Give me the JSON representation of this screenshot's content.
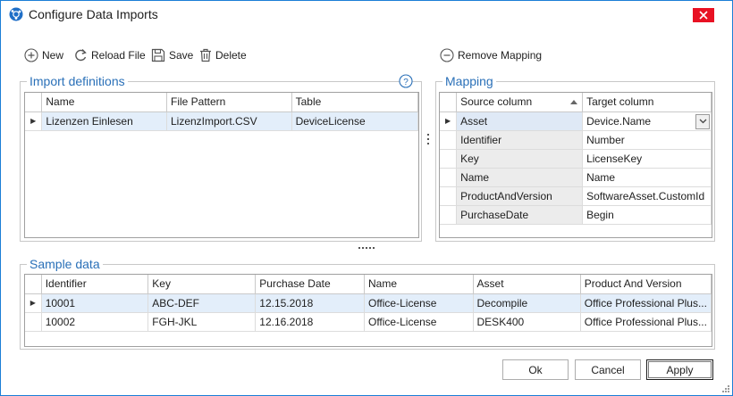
{
  "window": {
    "title": "Configure Data Imports"
  },
  "toolbar": {
    "new_label": "New",
    "reload_label": "Reload File",
    "save_label": "Save",
    "delete_label": "Delete",
    "remove_mapping_label": "Remove Mapping"
  },
  "import_definitions": {
    "title": "Import definitions",
    "columns": [
      "Name",
      "File Pattern",
      "Table"
    ],
    "rows": [
      [
        "Lizenzen Einlesen",
        "LizenzImport.CSV",
        "DeviceLicense"
      ]
    ]
  },
  "mapping": {
    "title": "Mapping",
    "columns": [
      "Source column",
      "Target column"
    ],
    "rows": [
      [
        "Asset",
        "Device.Name"
      ],
      [
        "Identifier",
        "Number"
      ],
      [
        "Key",
        "LicenseKey"
      ],
      [
        "Name",
        "Name"
      ],
      [
        "ProductAndVersion",
        "SoftwareAsset.CustomId"
      ],
      [
        "PurchaseDate",
        "Begin"
      ]
    ]
  },
  "sample_data": {
    "title": "Sample data",
    "columns": [
      "Identifier",
      "Key",
      "Purchase Date",
      "Name",
      "Asset",
      "Product And Version"
    ],
    "rows": [
      [
        "10001",
        "ABC-DEF",
        "12.15.2018",
        "Office-License",
        "Decompile",
        "Office Professional Plus..."
      ],
      [
        "10002",
        "FGH-JKL",
        "12.16.2018",
        "Office-License",
        "DESK400",
        "Office Professional Plus..."
      ]
    ]
  },
  "footer": {
    "ok_label": "Ok",
    "cancel_label": "Cancel",
    "apply_label": "Apply"
  },
  "colors": {
    "accent": "#2a70b8",
    "close": "#e81123",
    "selection": "#e3eefa",
    "border": "#1b7ed6"
  }
}
